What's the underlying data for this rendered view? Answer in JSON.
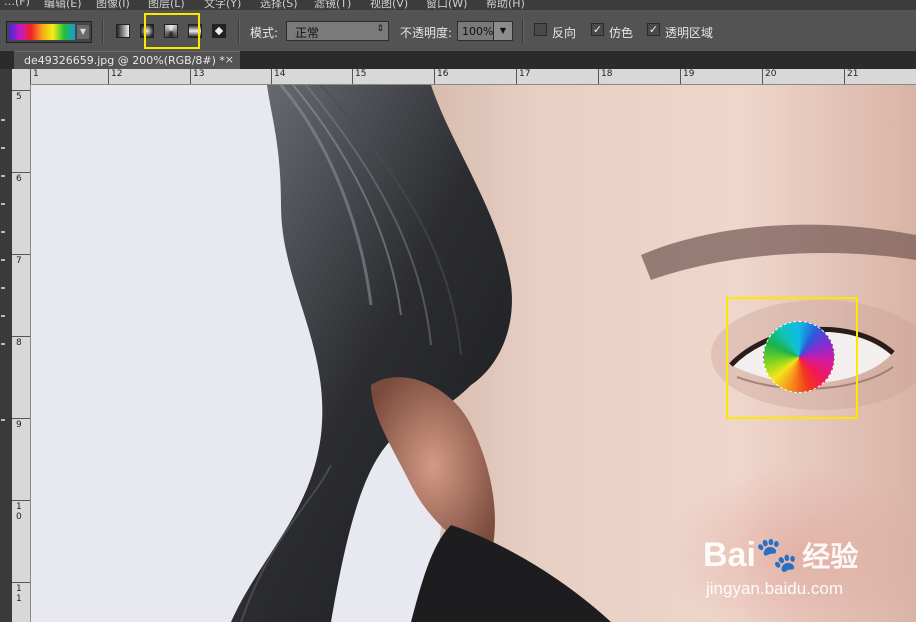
{
  "menubar": {
    "items": [
      "…(F)",
      "编辑(E)",
      "图像(I)",
      "图层(L)",
      "文字(Y)",
      "选择(S)",
      "滤镜(T)",
      "视图(V)",
      "窗口(W)",
      "帮助(H)"
    ]
  },
  "options_bar": {
    "gradient_picker": {
      "colors": [
        "#3b2bd6",
        "#c418c8",
        "#f21f2a",
        "#f6a51a",
        "#f2ef1a",
        "#20c03a",
        "#1b9ad1"
      ]
    },
    "gradient_types": [
      "linear-gradient",
      "radial-gradient",
      "angle-gradient",
      "reflected-gradient",
      "diamond-gradient"
    ],
    "selected_gradient_type": "angle-gradient",
    "mode_label": "模式:",
    "mode_value": "正常",
    "opacity_label": "不透明度:",
    "opacity_value": "100%",
    "reverse_label": "反向",
    "reverse_checked": false,
    "dither_label": "仿色",
    "dither_checked": true,
    "transparency_label": "透明区域",
    "transparency_checked": true,
    "highlight_color": "#ffe800"
  },
  "document": {
    "tab_title": "de49326659.jpg @ 200%(RGB/8#) *",
    "close_glyph": "×"
  },
  "rulers": {
    "horizontal": [
      "1",
      "12",
      "13",
      "14",
      "15",
      "16",
      "17",
      "18",
      "19",
      "20",
      "21"
    ],
    "vertical": [
      "5",
      "6",
      "7",
      "8",
      "9",
      "1\n0",
      "1\n1"
    ]
  },
  "watermark": {
    "brand": "Bai",
    "brand2": "经验",
    "url": "jingyan.baidu.com"
  }
}
